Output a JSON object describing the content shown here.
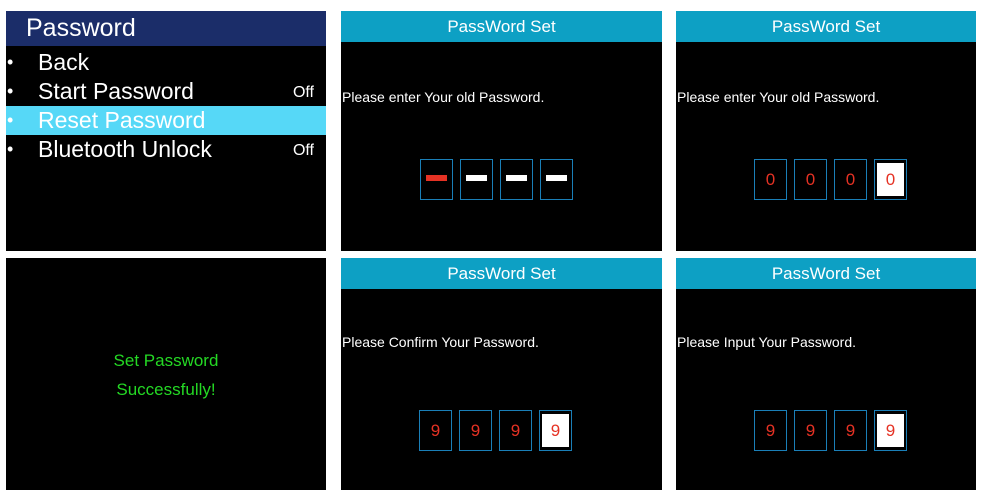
{
  "menu": {
    "title": "Password",
    "items": [
      {
        "bullet": "•",
        "label": "Back",
        "value": "",
        "selected": false
      },
      {
        "bullet": "•",
        "label": "Start Password",
        "value": "Off",
        "selected": false
      },
      {
        "bullet": "•",
        "label": "Reset Password",
        "value": "",
        "selected": true
      },
      {
        "bullet": "•",
        "label": "Bluetooth Unlock",
        "value": "Off",
        "selected": false
      }
    ]
  },
  "screens": {
    "old_empty": {
      "header": "PassWord Set",
      "prompt": "Please enter Your old Password."
    },
    "old_entered": {
      "header": "PassWord Set",
      "prompt": "Please enter Your old Password.",
      "digits": [
        "0",
        "0",
        "0",
        "0"
      ]
    },
    "success": {
      "line1": "Set Password",
      "line2": "Successfully!"
    },
    "confirm": {
      "header": "PassWord Set",
      "prompt": "Please Confirm Your Password.",
      "digits": [
        "9",
        "9",
        "9",
        "9"
      ]
    },
    "input": {
      "header": "PassWord Set",
      "prompt": "Please Input Your Password.",
      "digits": [
        "9",
        "9",
        "9",
        "9"
      ]
    }
  },
  "colors": {
    "menu_title_bg": "#1b2d69",
    "menu_selected_bg": "#56d8f7",
    "header_bg": "#0da0c4",
    "digit_color": "#e53224",
    "success_color": "#24d824"
  }
}
